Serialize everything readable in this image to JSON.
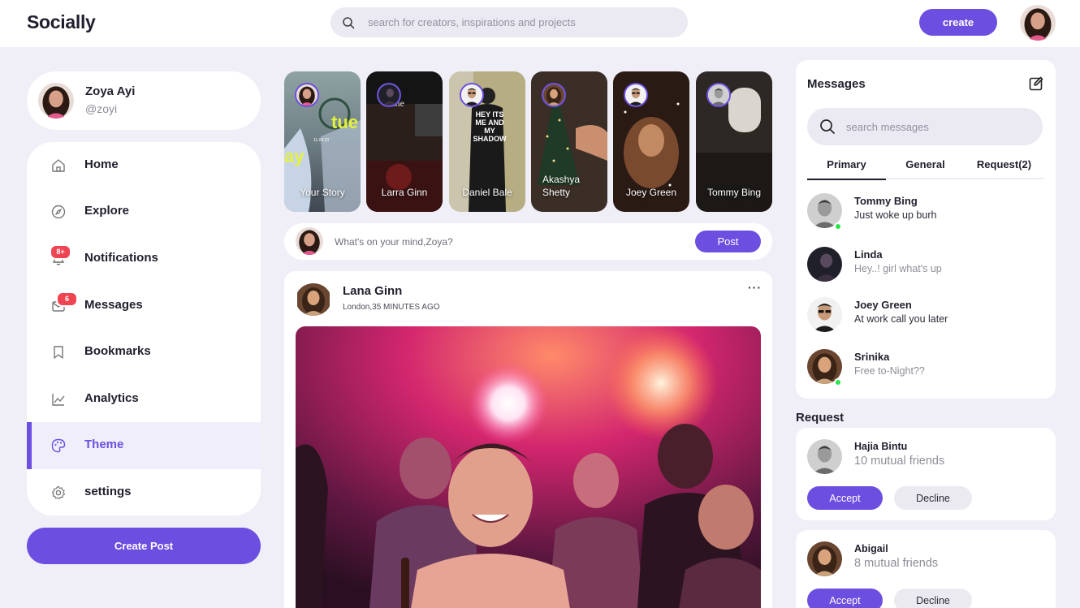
{
  "app": {
    "logo": "Socially"
  },
  "search": {
    "placeholder": "search for creators, inspirations and projects"
  },
  "header": {
    "create_label": "create"
  },
  "profile": {
    "name": "Zoya Ayi",
    "handle": "@zoyi"
  },
  "sidebar": {
    "items": [
      {
        "label": "Home",
        "icon": "home-icon"
      },
      {
        "label": "Explore",
        "icon": "compass-icon"
      },
      {
        "label": "Notifications",
        "icon": "bell-icon",
        "badge": "8+"
      },
      {
        "label": "Messages",
        "icon": "envelope-icon",
        "badge": "6"
      },
      {
        "label": "Bookmarks",
        "icon": "bookmark-icon"
      },
      {
        "label": "Analytics",
        "icon": "chart-icon"
      },
      {
        "label": "Theme",
        "icon": "palette-icon",
        "active": true
      },
      {
        "label": "settings",
        "icon": "gear-icon"
      }
    ],
    "create_post_label": "Create Post"
  },
  "stories": [
    {
      "name": "Your Story"
    },
    {
      "name": "Larra Ginn"
    },
    {
      "name": "Daniel Bale"
    },
    {
      "name": "Akashya Shetty"
    },
    {
      "name": "Joey Green"
    },
    {
      "name": "Tommy Bing"
    }
  ],
  "story_art": {
    "overlay_1": "tue",
    "overlay_1_small": "11.04.23",
    "overlay_1b": "ay",
    "overlay_2": "Time",
    "overlay_3": "HEY ITS ME AND MY SHADOW"
  },
  "composer": {
    "placeholder": "What's on your mind,Zoya?",
    "post_label": "Post"
  },
  "post": {
    "author": "Lana Ginn",
    "meta": "London,35 MINUTES AGO",
    "more": "···"
  },
  "messages": {
    "title": "Messages",
    "search_placeholder": "search messages",
    "tabs": [
      "Primary",
      "General",
      "Request(2)"
    ],
    "chats": [
      {
        "name": "Tommy Bing",
        "text": "Just woke up burh",
        "online": true
      },
      {
        "name": "Linda",
        "text": "Hey..! girl what's up",
        "online": false
      },
      {
        "name": "Joey Green",
        "text": "At work call you later",
        "online": false
      },
      {
        "name": "Srinika",
        "text": "Free to-Night??",
        "online": true
      }
    ]
  },
  "requests": {
    "title": "Request",
    "items": [
      {
        "name": "Hajia Bintu",
        "mutual": "10 mutual friends",
        "accept": "Accept",
        "decline": "Decline"
      },
      {
        "name": "Abigail",
        "mutual": "8 mutual friends",
        "accept": "Accept",
        "decline": "Decline"
      }
    ]
  },
  "colors": {
    "accent": "#6c4ee0",
    "background": "#f0eff8",
    "badge": "#ef4452",
    "online": "#29e34a"
  }
}
